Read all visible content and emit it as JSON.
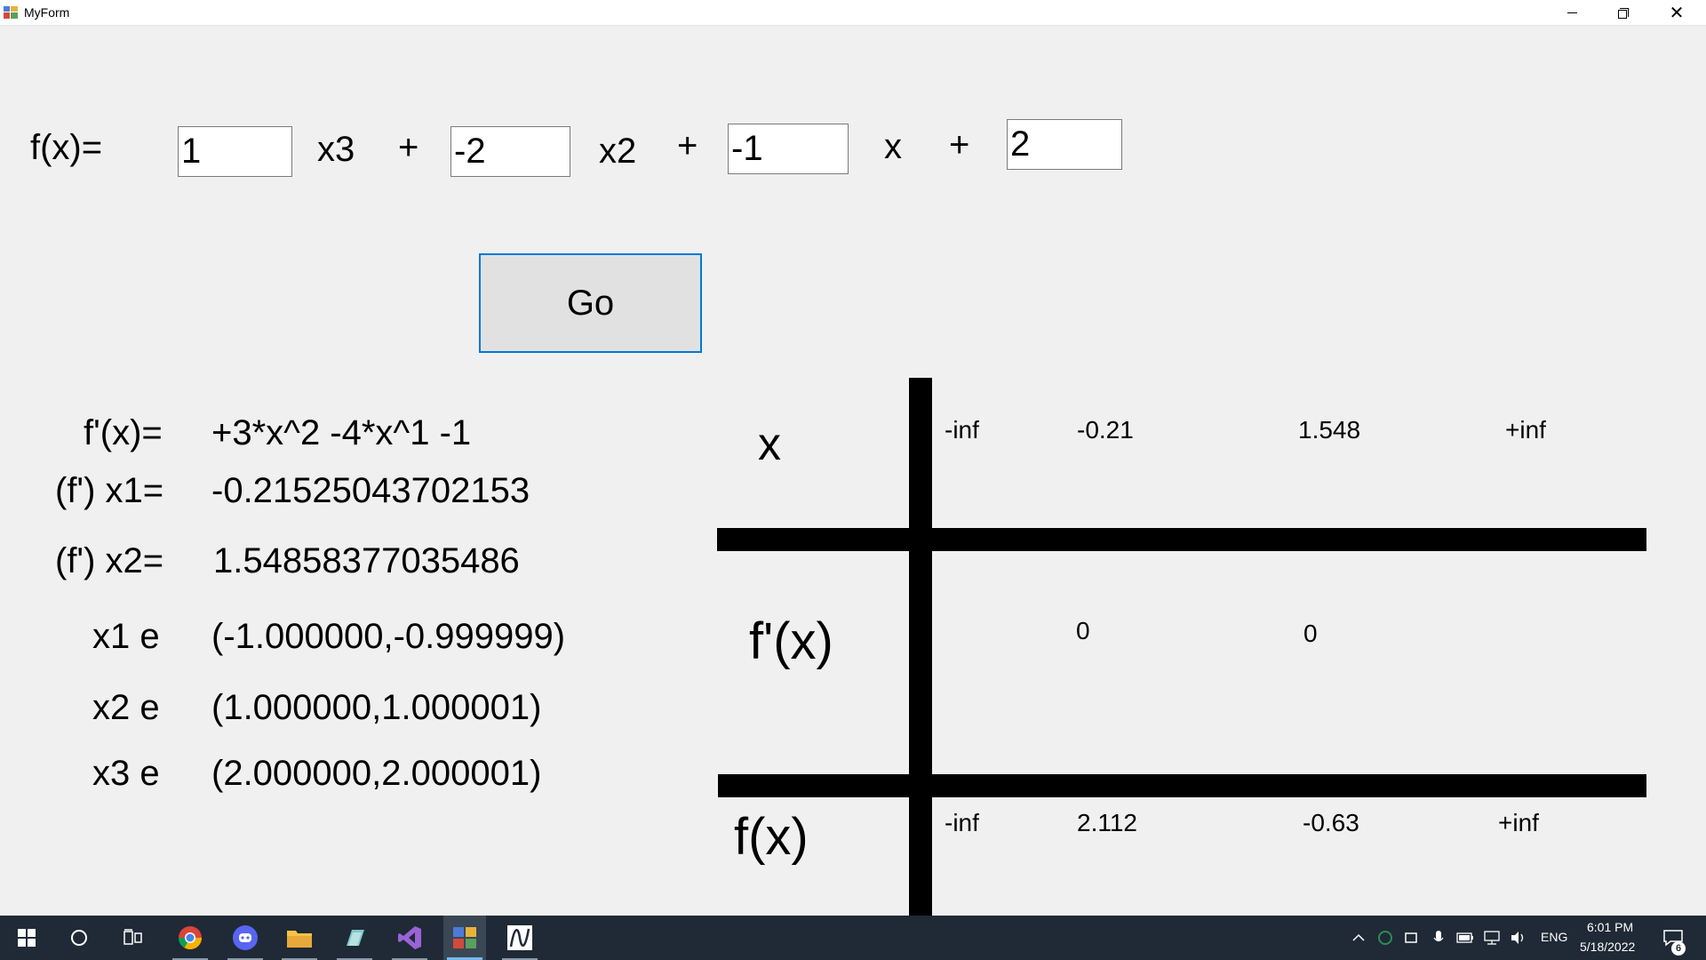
{
  "window": {
    "title": "MyForm"
  },
  "form": {
    "fx_label": "f(x)=",
    "coefficients": [
      "1",
      "-2",
      "-1",
      "2"
    ],
    "terms": [
      "x3",
      "x2",
      "x"
    ],
    "plus": "+",
    "go_label": "Go"
  },
  "results": {
    "derivative_label": "f'(x)=",
    "derivative_value": "+3*x^2 -4*x^1 -1",
    "x1_label": "(f')  x1=",
    "x1_value": "-0.21525043702153",
    "x2_label": "(f')  x2=",
    "x2_value": "1.54858377035486",
    "roots": [
      {
        "label": "x1 e",
        "interval": "(-1.000000,-0.999999)"
      },
      {
        "label": "x2 e",
        "interval": "(1.000000,1.000001)"
      },
      {
        "label": "x3 e",
        "interval": "(2.000000,2.000001)"
      }
    ]
  },
  "variation_table": {
    "row_labels": [
      "x",
      "f'(x)",
      "f(x)"
    ],
    "x_values": [
      "-inf",
      "-0.21",
      "1.548",
      "+inf"
    ],
    "fprime_values": [
      "0",
      "0"
    ],
    "f_values": [
      "-inf",
      "2.112",
      "-0.63",
      "+inf"
    ]
  },
  "taskbar": {
    "apps": [
      "start-icon",
      "search-icon",
      "task-view-icon",
      "chrome-icon",
      "discord-icon",
      "file-explorer-icon",
      "app-icon",
      "visual-studio-icon",
      "myform-icon",
      "graph-app-icon"
    ],
    "language": "ENG",
    "time": "6:01 PM",
    "date": "5/18/2022",
    "notification_count": "6"
  }
}
